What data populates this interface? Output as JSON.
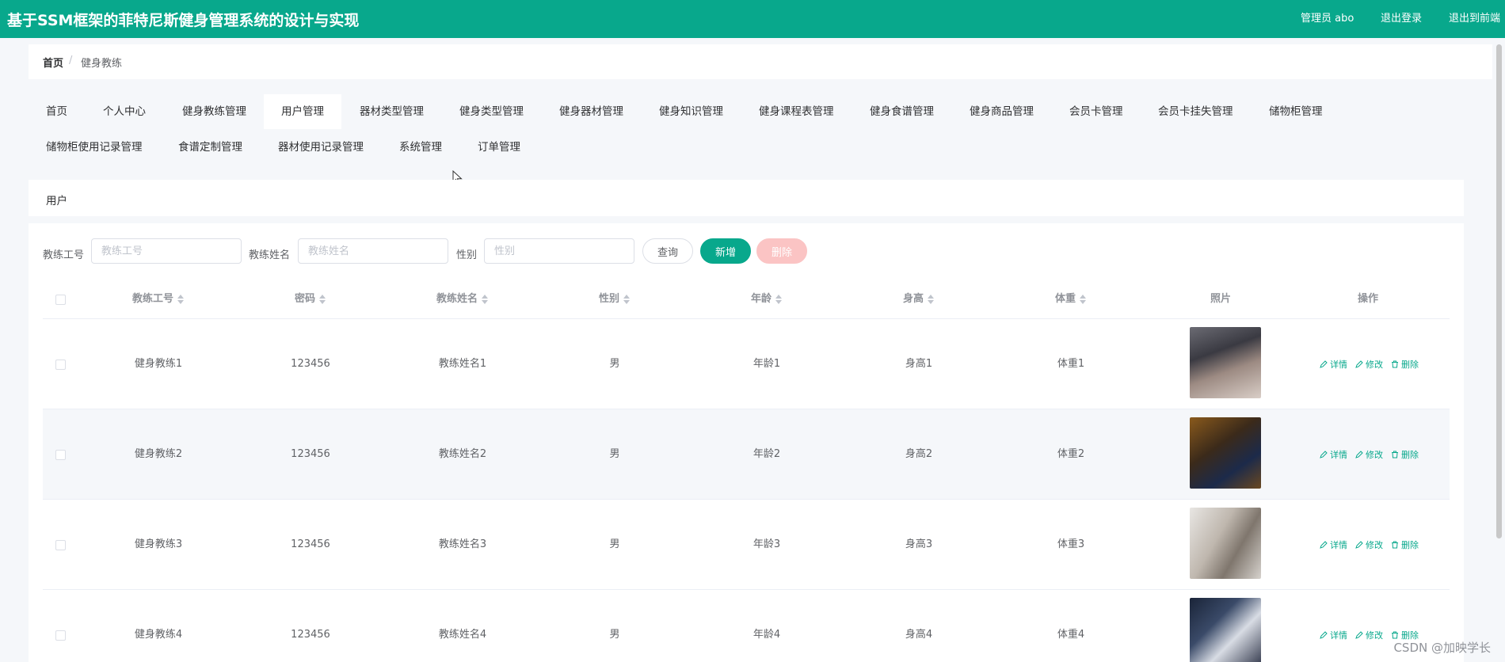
{
  "header": {
    "title": "基于SSM框架的菲特尼斯健身管理系统的设计与实现",
    "admin_label": "管理员 abo",
    "logout_label": "退出登录",
    "exit_front_label": "退出到前端"
  },
  "breadcrumb": {
    "home": "首页",
    "separator": "/",
    "current": "健身教练"
  },
  "nav": {
    "items": [
      "首页",
      "个人中心",
      "健身教练管理",
      "用户管理",
      "器材类型管理",
      "健身类型管理",
      "健身器材管理",
      "健身知识管理",
      "健身课程表管理",
      "健身食谱管理",
      "健身商品管理",
      "会员卡管理",
      "会员卡挂失管理",
      "储物柜管理",
      "储物柜使用记录管理",
      "食谱定制管理",
      "器材使用记录管理",
      "系统管理",
      "订单管理"
    ],
    "active": "用户管理"
  },
  "section": {
    "label": "用户"
  },
  "search": {
    "fields": [
      {
        "label": "教练工号",
        "placeholder": "教练工号"
      },
      {
        "label": "教练姓名",
        "placeholder": "教练姓名"
      },
      {
        "label": "性别",
        "placeholder": "性别"
      }
    ],
    "query_label": "查询",
    "add_label": "新增",
    "delete_label": "删除"
  },
  "table": {
    "columns": [
      "教练工号",
      "密码",
      "教练姓名",
      "性别",
      "年龄",
      "身高",
      "体重",
      "照片",
      "操作"
    ],
    "rows": [
      {
        "id": "健身教练1",
        "password": "123456",
        "name": "教练姓名1",
        "gender": "男",
        "age": "年龄1",
        "height": "身高1",
        "weight": "体重1"
      },
      {
        "id": "健身教练2",
        "password": "123456",
        "name": "教练姓名2",
        "gender": "男",
        "age": "年龄2",
        "height": "身高2",
        "weight": "体重2"
      },
      {
        "id": "健身教练3",
        "password": "123456",
        "name": "教练姓名3",
        "gender": "男",
        "age": "年龄3",
        "height": "身高3",
        "weight": "体重3"
      },
      {
        "id": "健身教练4",
        "password": "123456",
        "name": "教练姓名4",
        "gender": "男",
        "age": "年龄4",
        "height": "身高4",
        "weight": "体重4"
      }
    ],
    "actions": {
      "detail": "详情",
      "edit": "修改",
      "delete": "删除"
    }
  },
  "watermark": "CSDN @加映学长",
  "colors": {
    "primary": "#08a88c",
    "danger_light": "#fbc4c4",
    "bg": "#f5f7fa"
  }
}
